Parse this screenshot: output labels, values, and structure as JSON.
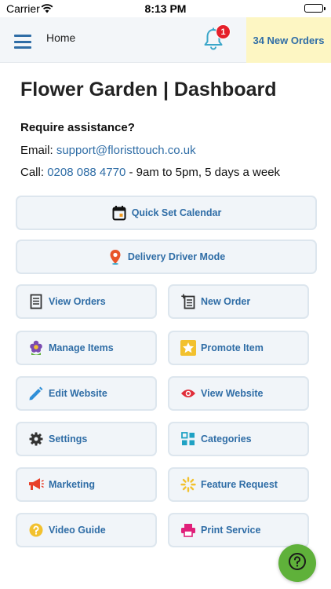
{
  "status_bar": {
    "carrier": "Carrier",
    "time": "8:13 PM"
  },
  "topbar": {
    "home_label": "Home",
    "notification_count": "1",
    "new_orders_label": "34 New Orders"
  },
  "header": {
    "title": "Flower Garden | Dashboard"
  },
  "assistance": {
    "heading": "Require assistance?",
    "email_label": "Email: ",
    "email": "support@floristtouch.co.uk",
    "call_label": "Call: ",
    "phone": "0208 088 4770",
    "hours": " - 9am to 5pm, 5 days a week"
  },
  "buttons": {
    "quick_set_calendar": "Quick Set Calendar",
    "delivery_driver_mode": "Delivery Driver Mode",
    "view_orders": "View Orders",
    "new_order": "New Order",
    "manage_items": "Manage Items",
    "promote_item": "Promote Item",
    "edit_website": "Edit Website",
    "view_website": "View Website",
    "settings": "Settings",
    "categories": "Categories",
    "marketing": "Marketing",
    "feature_request": "Feature Request",
    "video_guide": "Video Guide",
    "print_service": "Print Service"
  },
  "colors": {
    "accent": "#2f6da6",
    "orders_highlight": "#fdf6c3",
    "badge": "#e5202a",
    "help_button": "#5fb13a"
  }
}
